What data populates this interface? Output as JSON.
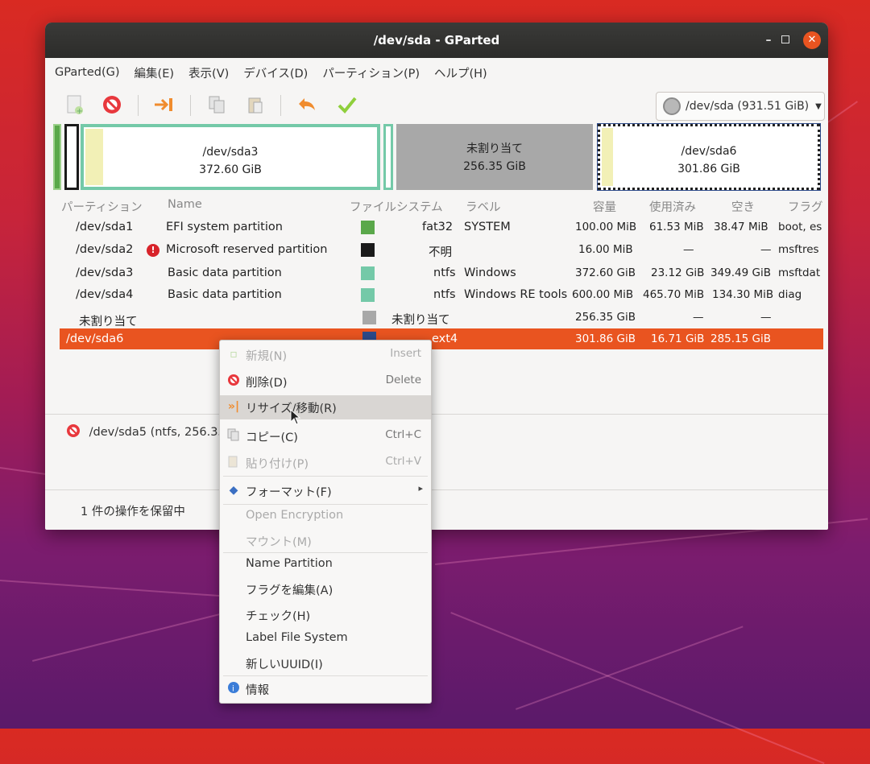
{
  "window": {
    "title": "/dev/sda - GParted",
    "controls": {
      "minimize": "–",
      "close": "✕"
    }
  },
  "menubar": [
    "GParted(G)",
    "編集(E)",
    "表示(V)",
    "デバイス(D)",
    "パーティション(P)",
    "ヘルプ(H)"
  ],
  "toolbar": {
    "icons": [
      "new-icon",
      "delete-icon",
      "resize-move-icon",
      "copy-icon",
      "paste-icon",
      "undo-icon",
      "apply-icon"
    ],
    "device_selector": "/dev/sda (931.51 GiB)"
  },
  "graph": {
    "sda3": {
      "name": "/dev/sda3",
      "size": "372.60 GiB"
    },
    "unalloc": {
      "name": "未割り当て",
      "size": "256.35 GiB"
    },
    "sda6": {
      "name": "/dev/sda6",
      "size": "301.86 GiB"
    }
  },
  "columns": [
    "パーティション",
    "Name",
    "ファイルシステム",
    "ラベル",
    "容量",
    "使用済み",
    "空き",
    "フラグ"
  ],
  "rows": [
    {
      "partition": "/dev/sda1",
      "name": "EFI system partition",
      "fs": "fat32",
      "fs_color": "#5aa84a",
      "label": "SYSTEM",
      "size": "100.00 MiB",
      "used": "61.53 MiB",
      "free": "38.47 MiB",
      "flags": "boot, es"
    },
    {
      "partition": "/dev/sda2",
      "warning": "!",
      "name": "Microsoft reserved partition",
      "fs": "不明",
      "fs_color": "#1a1a1a",
      "label": "",
      "size": "16.00 MiB",
      "used": "—",
      "free": "—",
      "flags": "msftres"
    },
    {
      "partition": "/dev/sda3",
      "name": "Basic data partition",
      "fs": "ntfs",
      "fs_color": "#74c9a8",
      "label": "Windows",
      "size": "372.60 GiB",
      "used": "23.12 GiB",
      "free": "349.49 GiB",
      "flags": "msftdat"
    },
    {
      "partition": "/dev/sda4",
      "name": "Basic data partition",
      "fs": "ntfs",
      "fs_color": "#74c9a8",
      "label": "Windows RE tools",
      "size": "600.00 MiB",
      "used": "465.70 MiB",
      "free": "134.30 MiB",
      "flags": "diag"
    },
    {
      "partition": "未割り当て",
      "name": "",
      "fs": "未割り当て",
      "fs_color": "#a8a8a8",
      "label": "",
      "size": "256.35 GiB",
      "used": "—",
      "free": "—",
      "flags": ""
    },
    {
      "partition": "/dev/sda6",
      "name": "",
      "fs": "ext4",
      "fs_color": "#2c4a8a",
      "label": "",
      "size": "301.86 GiB",
      "used": "16.71 GiB",
      "free": "285.15 GiB",
      "flags": ""
    }
  ],
  "pending_op": "/dev/sda5 (ntfs, 256.35",
  "status": "1 件の操作を保留中",
  "context_menu": [
    {
      "label": "新規(N)",
      "accel": "Insert",
      "enabled": false,
      "icon": "new-icon"
    },
    {
      "label": "削除(D)",
      "accel": "Delete",
      "enabled": true,
      "icon": "delete-icon"
    },
    {
      "label": "リサイズ/移動(R)",
      "accel": "",
      "enabled": true,
      "icon": "resize-move-icon"
    },
    {
      "label": "コピー(C)",
      "accel": "Ctrl+C",
      "enabled": true,
      "icon": "copy-icon"
    },
    {
      "label": "貼り付け(P)",
      "accel": "Ctrl+V",
      "enabled": false,
      "icon": "paste-icon"
    },
    {
      "label": "フォーマット(F)",
      "accel": "",
      "enabled": true,
      "icon": "format-icon",
      "submenu": "▸"
    },
    {
      "label": "Open Encryption",
      "accel": "",
      "enabled": false
    },
    {
      "label": "マウント(M)",
      "accel": "",
      "enabled": false
    },
    {
      "label": "Name Partition",
      "accel": "",
      "enabled": true
    },
    {
      "label": "フラグを編集(A)",
      "accel": "",
      "enabled": true
    },
    {
      "label": "チェック(H)",
      "accel": "",
      "enabled": true
    },
    {
      "label": "Label File System",
      "accel": "",
      "enabled": true
    },
    {
      "label": "新しいUUID(I)",
      "accel": "",
      "enabled": true
    },
    {
      "label": "情報",
      "accel": "",
      "enabled": true,
      "icon": "info-icon"
    }
  ],
  "colors": {
    "accent": "#e95420",
    "titlebar": "#2c2c2a",
    "ntfs": "#74c9a8",
    "fat32": "#5aa84a",
    "unallocated": "#a8a8a8",
    "ext4": "#2c4a8a"
  }
}
